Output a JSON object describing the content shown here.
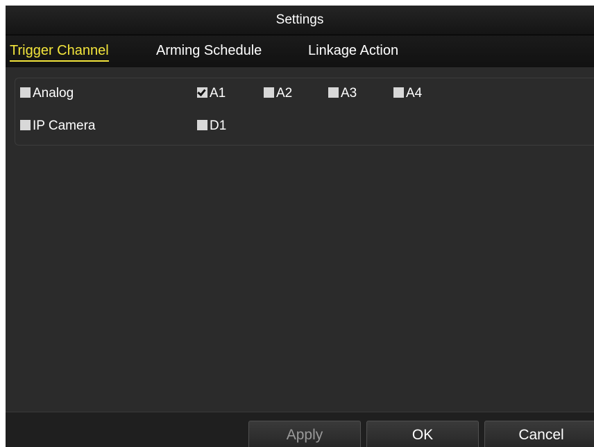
{
  "window": {
    "title": "Settings"
  },
  "tabs": [
    {
      "label": "Trigger Channel",
      "active": true
    },
    {
      "label": "Arming Schedule",
      "active": false
    },
    {
      "label": "Linkage Action",
      "active": false
    }
  ],
  "groups": [
    {
      "label": "Analog",
      "checked": false,
      "channels": [
        {
          "label": "A1",
          "checked": true
        },
        {
          "label": "A2",
          "checked": false
        },
        {
          "label": "A3",
          "checked": false
        },
        {
          "label": "A4",
          "checked": false
        }
      ]
    },
    {
      "label": "IP Camera",
      "checked": false,
      "channels": [
        {
          "label": "D1",
          "checked": false
        }
      ]
    }
  ],
  "buttons": {
    "apply": "Apply",
    "ok": "OK",
    "cancel": "Cancel"
  },
  "colors": {
    "active_tab": "#f3e53c",
    "background": "#2b2b2b",
    "checkbox": "#d8d8d8"
  }
}
